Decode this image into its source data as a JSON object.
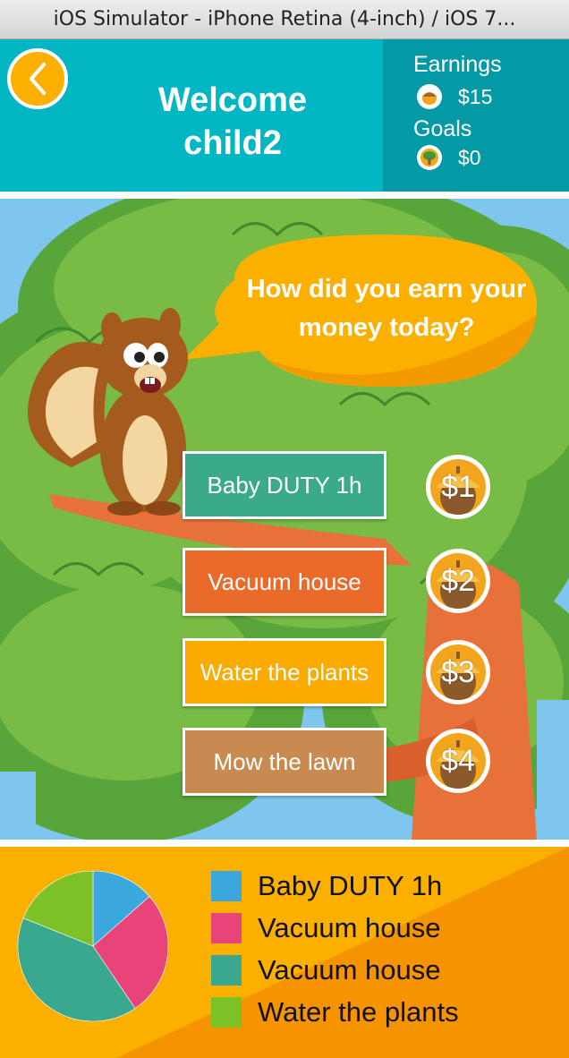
{
  "window": {
    "title": "iOS Simulator - iPhone Retina (4-inch) / iOS 7..."
  },
  "header": {
    "welcome_line1": "Welcome",
    "welcome_line2": "child2",
    "earnings_label": "Earnings",
    "earnings_value": "$15",
    "goals_label": "Goals",
    "goals_value": "$0"
  },
  "scene": {
    "speech": "How did you earn your money today?",
    "chores": [
      {
        "label": "Baby DUTY 1h",
        "price": "$1",
        "color": "#3aaa8a"
      },
      {
        "label": "Vacuum house",
        "price": "$2",
        "color": "#ea6a2a"
      },
      {
        "label": "Water the plants",
        "price": "$3",
        "color": "#fbab00"
      },
      {
        "label": "Mow the lawn",
        "price": "$4",
        "color": "#c88a50"
      }
    ]
  },
  "legend": {
    "items": [
      {
        "label": "Baby DUTY 1h",
        "color": "#3aa8dc"
      },
      {
        "label": "Vacuum house",
        "color": "#e8447a"
      },
      {
        "label": "Vacuum house",
        "color": "#39a88e"
      },
      {
        "label": "Water the plants",
        "color": "#7cc227"
      }
    ]
  },
  "chart_data": {
    "type": "pie",
    "categories": [
      "Baby DUTY 1h",
      "Vacuum house",
      "Vacuum house",
      "Water the plants"
    ],
    "values": [
      1,
      2,
      3,
      1.4
    ],
    "colors": [
      "#3aa8dc",
      "#e8447a",
      "#39a88e",
      "#7cc227"
    ]
  },
  "icons": {
    "back": "chevron-left-icon",
    "earnings": "acorn-icon",
    "goals": "tree-icon",
    "price": "acorn-icon"
  }
}
